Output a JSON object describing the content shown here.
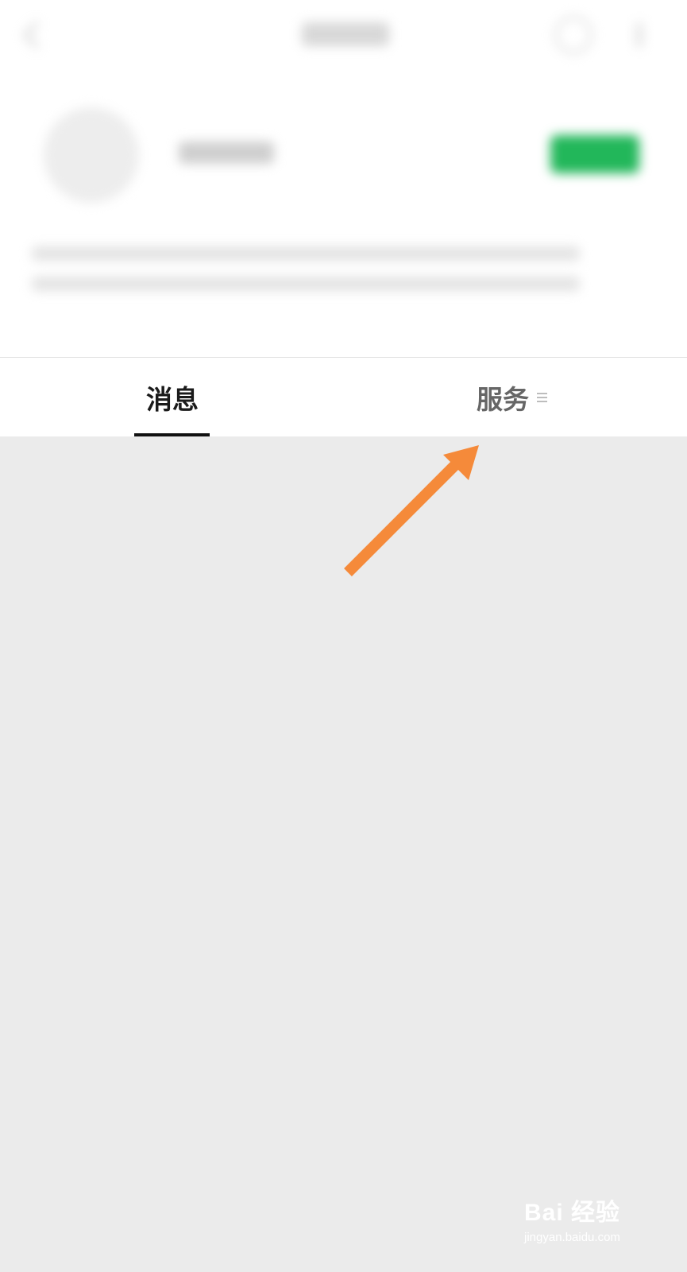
{
  "tabs": {
    "messages_label": "消息",
    "services_label": "服务",
    "active_tab": "消息"
  },
  "icons": {
    "back": "back-arrow-icon",
    "profile": "person-icon",
    "more": "more-icon",
    "menu": "menu-icon",
    "annotation": "annotation-arrow"
  },
  "colors": {
    "follow_button": "#22b75a",
    "annotation_arrow": "#f58a3a",
    "tab_active": "#1a1a1a",
    "tab_inactive": "#666666",
    "content_background": "#ebebeb"
  },
  "watermark": {
    "brand": "Bai 经验",
    "url": "jingyan.baidu.com"
  }
}
